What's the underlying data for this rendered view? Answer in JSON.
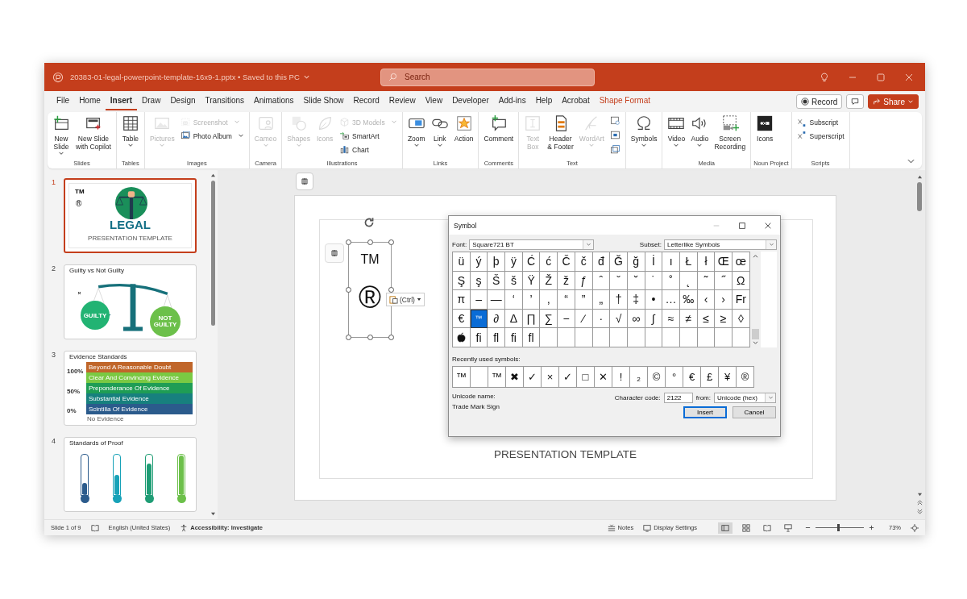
{
  "window": {
    "title": "20383-01-legal-powerpoint-template-16x9-1.pptx • Saved to this PC",
    "search_placeholder": "Search"
  },
  "tabs": [
    {
      "label": "File",
      "selected": false,
      "kind": "normal"
    },
    {
      "label": "Home",
      "selected": false,
      "kind": "normal"
    },
    {
      "label": "Insert",
      "selected": true,
      "kind": "normal"
    },
    {
      "label": "Draw",
      "selected": false,
      "kind": "normal"
    },
    {
      "label": "Design",
      "selected": false,
      "kind": "normal"
    },
    {
      "label": "Transitions",
      "selected": false,
      "kind": "normal"
    },
    {
      "label": "Animations",
      "selected": false,
      "kind": "normal"
    },
    {
      "label": "Slide Show",
      "selected": false,
      "kind": "normal"
    },
    {
      "label": "Record",
      "selected": false,
      "kind": "normal"
    },
    {
      "label": "Review",
      "selected": false,
      "kind": "normal"
    },
    {
      "label": "View",
      "selected": false,
      "kind": "normal"
    },
    {
      "label": "Developer",
      "selected": false,
      "kind": "normal"
    },
    {
      "label": "Add-ins",
      "selected": false,
      "kind": "normal"
    },
    {
      "label": "Help",
      "selected": false,
      "kind": "normal"
    },
    {
      "label": "Acrobat",
      "selected": false,
      "kind": "normal"
    },
    {
      "label": "Shape Format",
      "selected": false,
      "kind": "contextual"
    }
  ],
  "tab_bar_buttons": {
    "record": "Record",
    "share": "Share"
  },
  "ribbon": {
    "groups": [
      {
        "label": "Slides",
        "items": [
          {
            "label": "New\nSlide",
            "kind": "large",
            "disabled": false,
            "dropdown": true
          },
          {
            "label": "New Slide\nwith Copilot",
            "kind": "large",
            "disabled": false,
            "dropdown": false
          }
        ]
      },
      {
        "label": "Tables",
        "items": [
          {
            "label": "Table",
            "kind": "large",
            "disabled": false,
            "dropdown": true
          }
        ]
      },
      {
        "label": "Images",
        "items": [
          {
            "label": "Pictures",
            "kind": "large",
            "disabled": true,
            "dropdown": true
          },
          {
            "label": "Screenshot",
            "kind": "small",
            "disabled": true,
            "dropdown": true
          },
          {
            "label": "Photo Album",
            "kind": "small",
            "disabled": false,
            "dropdown": true
          }
        ]
      },
      {
        "label": "Camera",
        "items": [
          {
            "label": "Cameo",
            "kind": "large",
            "disabled": true,
            "dropdown": true
          }
        ]
      },
      {
        "label": "Illustrations",
        "items": [
          {
            "label": "Shapes",
            "kind": "large",
            "disabled": true,
            "dropdown": true
          },
          {
            "label": "Icons",
            "kind": "large",
            "disabled": true,
            "dropdown": false
          },
          {
            "label": "3D Models",
            "kind": "small",
            "disabled": true,
            "dropdown": true
          },
          {
            "label": "SmartArt",
            "kind": "small",
            "disabled": false,
            "dropdown": false
          },
          {
            "label": "Chart",
            "kind": "small",
            "disabled": false,
            "dropdown": false
          }
        ]
      },
      {
        "label": "Links",
        "items": [
          {
            "label": "Zoom",
            "kind": "large",
            "disabled": false,
            "dropdown": true
          },
          {
            "label": "Link",
            "kind": "large",
            "disabled": false,
            "dropdown": true
          },
          {
            "label": "Action",
            "kind": "large",
            "disabled": false,
            "dropdown": false
          }
        ]
      },
      {
        "label": "Comments",
        "items": [
          {
            "label": "Comment",
            "kind": "large",
            "disabled": false,
            "dropdown": false
          }
        ]
      },
      {
        "label": "Text",
        "items": [
          {
            "label": "Text\nBox",
            "kind": "large",
            "disabled": true,
            "dropdown": false
          },
          {
            "label": "Header\n& Footer",
            "kind": "large",
            "disabled": false,
            "dropdown": false
          },
          {
            "label": "WordArt",
            "kind": "large",
            "disabled": true,
            "dropdown": true
          },
          {
            "kind": "icon",
            "disabled": false,
            "dropdown": false
          },
          {
            "kind": "icon",
            "disabled": false,
            "dropdown": false
          },
          {
            "kind": "icon",
            "disabled": false,
            "dropdown": false
          }
        ]
      },
      {
        "items": [
          {
            "label": "Symbols",
            "kind": "large",
            "disabled": false,
            "dropdown": true
          }
        ]
      },
      {
        "label": "Media",
        "items": [
          {
            "label": "Video",
            "kind": "large",
            "disabled": false,
            "dropdown": true
          },
          {
            "label": "Audio",
            "kind": "large",
            "disabled": false,
            "dropdown": true
          },
          {
            "label": "Screen\nRecording",
            "kind": "large",
            "disabled": false,
            "dropdown": false
          }
        ]
      },
      {
        "label": "Noun Project",
        "items": [
          {
            "label": "Icons",
            "kind": "large",
            "disabled": false,
            "dropdown": false
          }
        ]
      },
      {
        "label": "Scripts",
        "items": [
          {
            "label": "Subscript",
            "kind": "small",
            "disabled": false,
            "dropdown": false
          },
          {
            "label": "Superscript",
            "kind": "small",
            "disabled": false,
            "dropdown": false
          }
        ]
      }
    ]
  },
  "thumbnails": [
    {
      "number": "1",
      "selected": true,
      "kind": "title",
      "tm": "TM",
      "reg": "®",
      "heading": "LEGAL",
      "subtitle": "PRESENTATION TEMPLATE"
    },
    {
      "number": "2",
      "selected": false,
      "kind": "scale",
      "title": "Guilty vs Not Guilty",
      "left_label": "GUILTY",
      "right_label": "NOT GUILTY"
    },
    {
      "number": "3",
      "selected": false,
      "kind": "bands",
      "title": "Evidence Standards",
      "bands": [
        {
          "label": "Beyond A Reasonable Doubt",
          "color": "#c0662a"
        },
        {
          "label": "Clear And Convincing Evidence",
          "color": "#7ac943"
        },
        {
          "label": "Preponderance Of Evidence",
          "color": "#1f9d55"
        },
        {
          "label": "Substantial Evidence",
          "color": "#17807e"
        },
        {
          "label": "Scintilla Of Evidence",
          "color": "#2b5b8c"
        }
      ],
      "axis": [
        "100%",
        "50%",
        "0%"
      ],
      "footer": "No Evidence"
    },
    {
      "number": "4",
      "selected": false,
      "kind": "thermometers",
      "title": "Standards of Proof",
      "gauges": [
        {
          "level": 0.3,
          "color": "#2b5b8c"
        },
        {
          "level": 0.5,
          "color": "#17a2b8"
        },
        {
          "level": 0.8,
          "color": "#1f9d75"
        },
        {
          "level": 1,
          "color": "#6cc04a"
        }
      ]
    }
  ],
  "slide": {
    "textbox": [
      "TM",
      "®"
    ],
    "paste_button": "(Ctrl)",
    "subtitle": "PRESENTATION TEMPLATE"
  },
  "symbol_dialog": {
    "title": "Symbol",
    "font_label": "Font:",
    "font": "Square721 BT",
    "subset_label": "Subset:",
    "subset": "Letterlike Symbols",
    "rows": [
      [
        {
          "kind": "glyph",
          "char": "ü",
          "selected": false
        },
        {
          "kind": "glyph",
          "char": "ý",
          "selected": false
        },
        {
          "kind": "glyph",
          "char": "þ",
          "selected": false
        },
        {
          "kind": "glyph",
          "char": "ÿ",
          "selected": false
        },
        {
          "kind": "glyph",
          "char": "Ć",
          "selected": false
        },
        {
          "kind": "glyph",
          "char": "ć",
          "selected": false
        },
        {
          "kind": "glyph",
          "char": "Č",
          "selected": false
        },
        {
          "kind": "glyph",
          "char": "č",
          "selected": false
        },
        {
          "kind": "glyph",
          "char": "đ",
          "selected": false
        },
        {
          "kind": "glyph",
          "char": "Ğ",
          "selected": false
        },
        {
          "kind": "glyph",
          "char": "ğ",
          "selected": false
        },
        {
          "kind": "glyph",
          "char": "İ",
          "selected": false
        },
        {
          "kind": "glyph",
          "char": "ı",
          "selected": false
        },
        {
          "kind": "glyph",
          "char": "Ł",
          "selected": false
        },
        {
          "kind": "glyph",
          "char": "ł",
          "selected": false
        },
        {
          "kind": "glyph",
          "char": "Œ",
          "selected": false
        },
        {
          "kind": "glyph",
          "char": "œ",
          "selected": false
        }
      ],
      [
        {
          "kind": "glyph",
          "char": "Ş",
          "selected": false
        },
        {
          "kind": "glyph",
          "char": "ş",
          "selected": false
        },
        {
          "kind": "glyph",
          "char": "Š",
          "selected": false
        },
        {
          "kind": "glyph",
          "char": "š",
          "selected": false
        },
        {
          "kind": "glyph",
          "char": "Ÿ",
          "selected": false
        },
        {
          "kind": "glyph",
          "char": "Ž",
          "selected": false
        },
        {
          "kind": "glyph",
          "char": "ž",
          "selected": false
        },
        {
          "kind": "glyph",
          "char": "ƒ",
          "selected": false
        },
        {
          "kind": "glyph",
          "char": "ˆ",
          "selected": false
        },
        {
          "kind": "glyph",
          "char": "ˇ",
          "selected": false
        },
        {
          "kind": "glyph",
          "char": "˘",
          "selected": false
        },
        {
          "kind": "glyph",
          "char": "˙",
          "selected": false
        },
        {
          "kind": "glyph",
          "char": "˚",
          "selected": false
        },
        {
          "kind": "glyph",
          "char": "˛",
          "selected": false
        },
        {
          "kind": "glyph",
          "char": "˜",
          "selected": false
        },
        {
          "kind": "glyph",
          "char": "˝",
          "selected": false
        },
        {
          "kind": "glyph",
          "char": "Ω",
          "selected": false
        }
      ],
      [
        {
          "kind": "glyph",
          "char": "π",
          "selected": false
        },
        {
          "kind": "glyph",
          "char": "–",
          "selected": false
        },
        {
          "kind": "glyph",
          "char": "—",
          "selected": false
        },
        {
          "kind": "glyph",
          "char": "‘",
          "selected": false
        },
        {
          "kind": "glyph",
          "char": "’",
          "selected": false
        },
        {
          "kind": "glyph",
          "char": "‚",
          "selected": false
        },
        {
          "kind": "glyph",
          "char": "“",
          "selected": false
        },
        {
          "kind": "glyph",
          "char": "”",
          "selected": false
        },
        {
          "kind": "glyph",
          "char": "„",
          "selected": false
        },
        {
          "kind": "glyph",
          "char": "†",
          "selected": false
        },
        {
          "kind": "glyph",
          "char": "‡",
          "selected": false
        },
        {
          "kind": "glyph",
          "char": "•",
          "selected": false
        },
        {
          "kind": "glyph",
          "char": "…",
          "selected": false
        },
        {
          "kind": "glyph",
          "char": "‰",
          "selected": false
        },
        {
          "kind": "glyph",
          "char": "‹",
          "selected": false
        },
        {
          "kind": "glyph",
          "char": "›",
          "selected": false
        },
        {
          "kind": "glyph",
          "char": "Fr",
          "selected": false
        }
      ],
      [
        {
          "kind": "glyph",
          "char": "€",
          "selected": false
        },
        {
          "kind": "glyph",
          "char": "™",
          "selected": true
        },
        {
          "kind": "glyph",
          "char": "∂",
          "selected": false
        },
        {
          "kind": "glyph",
          "char": "Δ",
          "selected": false
        },
        {
          "kind": "glyph",
          "char": "∏",
          "selected": false
        },
        {
          "kind": "glyph",
          "char": "∑",
          "selected": false
        },
        {
          "kind": "glyph",
          "char": "−",
          "selected": false
        },
        {
          "kind": "glyph",
          "char": "∕",
          "selected": false
        },
        {
          "kind": "glyph",
          "char": "·",
          "selected": false
        },
        {
          "kind": "glyph",
          "char": "√",
          "selected": false
        },
        {
          "kind": "glyph",
          "char": "∞",
          "selected": false
        },
        {
          "kind": "glyph",
          "char": "∫",
          "selected": false
        },
        {
          "kind": "glyph",
          "char": "≈",
          "selected": false
        },
        {
          "kind": "glyph",
          "char": "≠",
          "selected": false
        },
        {
          "kind": "glyph",
          "char": "≤",
          "selected": false
        },
        {
          "kind": "glyph",
          "char": "≥",
          "selected": false
        },
        {
          "kind": "glyph",
          "char": "◊",
          "selected": false
        }
      ],
      [
        {
          "kind": "apple",
          "selected": false
        },
        {
          "kind": "glyph",
          "char": "fi",
          "selected": false
        },
        {
          "kind": "glyph",
          "char": "fl",
          "selected": false
        },
        {
          "kind": "glyph",
          "char": "fi",
          "selected": false
        },
        {
          "kind": "glyph",
          "char": "fl",
          "selected": false
        }
      ]
    ],
    "recent_label": "Recently used symbols:",
    "recent": [
      {
        "kind": "glyph",
        "char": "™"
      },
      {
        "kind": "blank"
      },
      {
        "kind": "glyph",
        "char": "™"
      },
      {
        "kind": "glyph",
        "char": "✖"
      },
      {
        "kind": "glyph",
        "char": "✓"
      },
      {
        "kind": "glyph",
        "char": "×"
      },
      {
        "kind": "glyph",
        "char": "✓"
      },
      {
        "kind": "glyph",
        "char": "□"
      },
      {
        "kind": "glyph",
        "char": "✕"
      },
      {
        "kind": "glyph",
        "char": "!"
      },
      {
        "kind": "glyph",
        "char": "₂"
      },
      {
        "kind": "glyph",
        "char": "©"
      },
      {
        "kind": "glyph",
        "char": "°"
      },
      {
        "kind": "glyph",
        "char": "€"
      },
      {
        "kind": "glyph",
        "char": "£"
      },
      {
        "kind": "glyph",
        "char": "¥"
      },
      {
        "kind": "glyph",
        "char": "®"
      }
    ],
    "unicode_name_label": "Unicode name:",
    "unicode_name": "Trade Mark Sign",
    "code_label": "Character code:",
    "code": "2122",
    "from_label": "from:",
    "from": "Unicode (hex)",
    "buttons": [
      {
        "label": "Insert",
        "default": true
      },
      {
        "label": "Cancel",
        "default": false
      }
    ]
  },
  "status_bar": {
    "slide": "Slide 1 of 9",
    "language": "English (United States)",
    "accessibility": "Accessibility: Investigate",
    "notes": "Notes",
    "display": "Display Settings",
    "views": [
      {
        "selected": true
      },
      {
        "selected": false
      },
      {
        "selected": false
      },
      {
        "selected": false
      }
    ],
    "zoom": {
      "level": 0.45,
      "reading": "73%"
    }
  }
}
